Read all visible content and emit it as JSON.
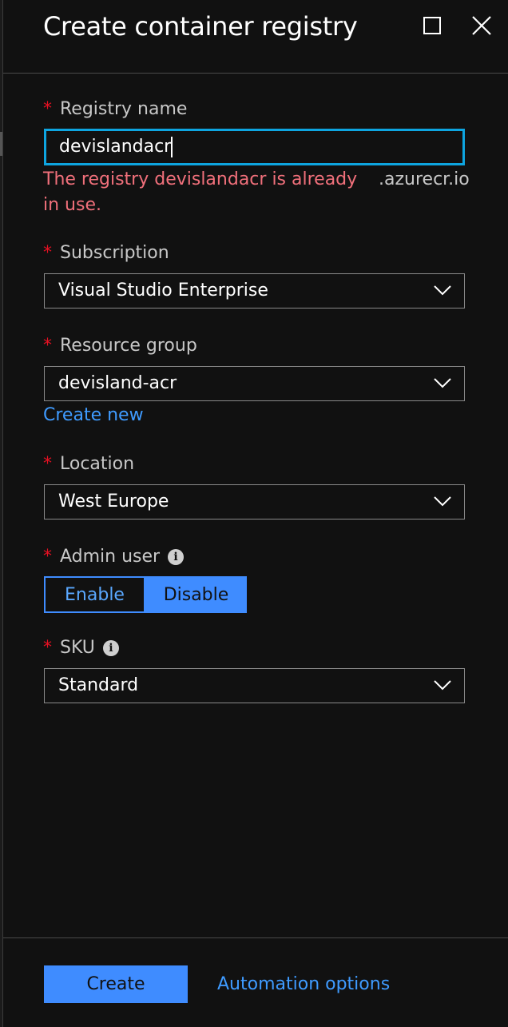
{
  "header": {
    "title": "Create container registry"
  },
  "registry_name": {
    "label": "Registry name",
    "value": "devislandacr",
    "error": "The registry devislandacr is already in use.",
    "suffix": ".azurecr.io"
  },
  "subscription": {
    "label": "Subscription",
    "value": "Visual Studio Enterprise"
  },
  "resource_group": {
    "label": "Resource group",
    "value": "devisland-acr",
    "create_new": "Create new"
  },
  "location": {
    "label": "Location",
    "value": "West Europe"
  },
  "admin_user": {
    "label": "Admin user",
    "options": [
      "Enable",
      "Disable"
    ],
    "selected": "Disable"
  },
  "sku": {
    "label": "SKU",
    "value": "Standard"
  },
  "footer": {
    "create_label": "Create",
    "automation_label": "Automation options"
  },
  "required_marker": "*",
  "info_glyph": "i",
  "colors": {
    "accent": "#3f8cff",
    "focus_border": "#0ea5e0",
    "error": "#f1707b",
    "required": "#e81123",
    "background": "#111111"
  },
  "icons": [
    "maximize-icon",
    "close-icon",
    "chevron-down-icon",
    "info-icon"
  ]
}
